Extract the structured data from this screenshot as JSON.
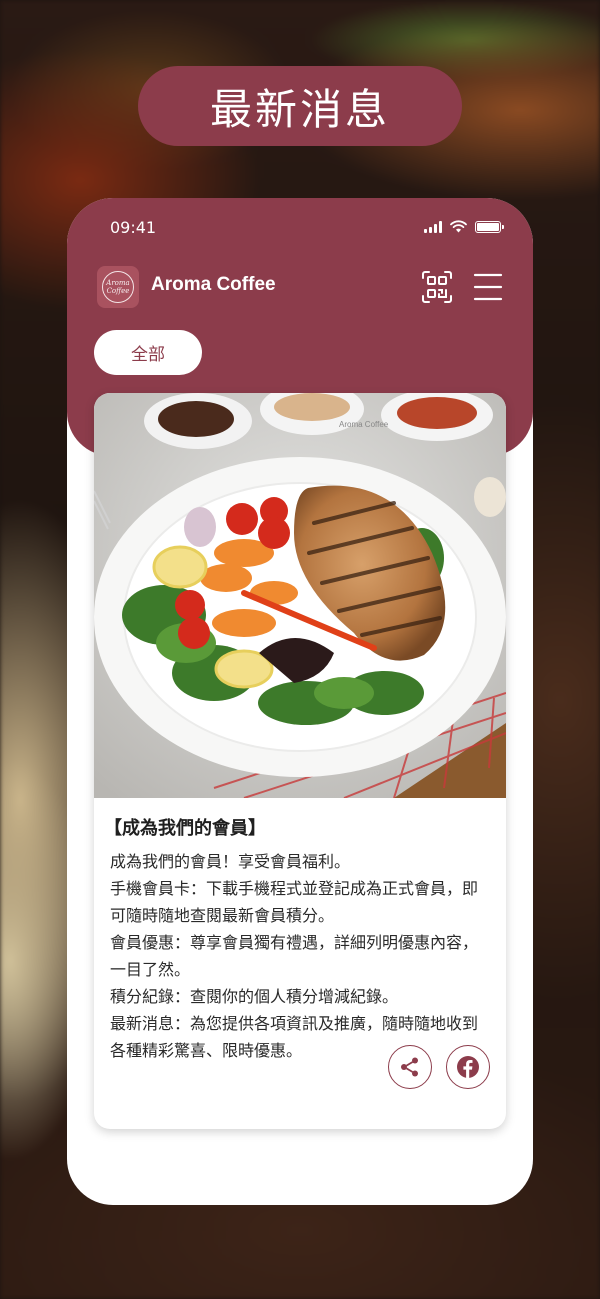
{
  "page_title": "最新消息",
  "status_bar": {
    "time": "09:41"
  },
  "app": {
    "name": "Aroma Coffee",
    "logo_line1": "Aroma",
    "logo_line2": "Coffee"
  },
  "filter_chips": [
    {
      "label": "全部",
      "selected": true
    }
  ],
  "news": {
    "title": "【成為我們的會員】",
    "paragraphs": [
      "成為我們的會員！享受會員福利。",
      "手機會員卡：下載手機程式並登記成為正式會員，即可隨時隨地查閱最新會員積分。",
      "會員優惠：尊享會員獨有禮遇，詳細列明優惠內容，一目了然。",
      "積分紀錄：查閱你的個人積分增減紀錄。",
      "最新消息：為您提供各項資訊及推廣，隨時隨地收到各種精彩驚喜、限時優惠。"
    ],
    "image_watermark": "Aroma Coffee",
    "image_subject": "grilled chicken breast with vegetables on white plate"
  },
  "icons": {
    "qr": "qr-code-scan-icon",
    "menu": "hamburger-menu-icon",
    "share": "share-icon",
    "facebook": "facebook-icon"
  },
  "colors": {
    "brand": "#8c3c4b",
    "background_dark": "#1c1411",
    "white": "#ffffff"
  }
}
